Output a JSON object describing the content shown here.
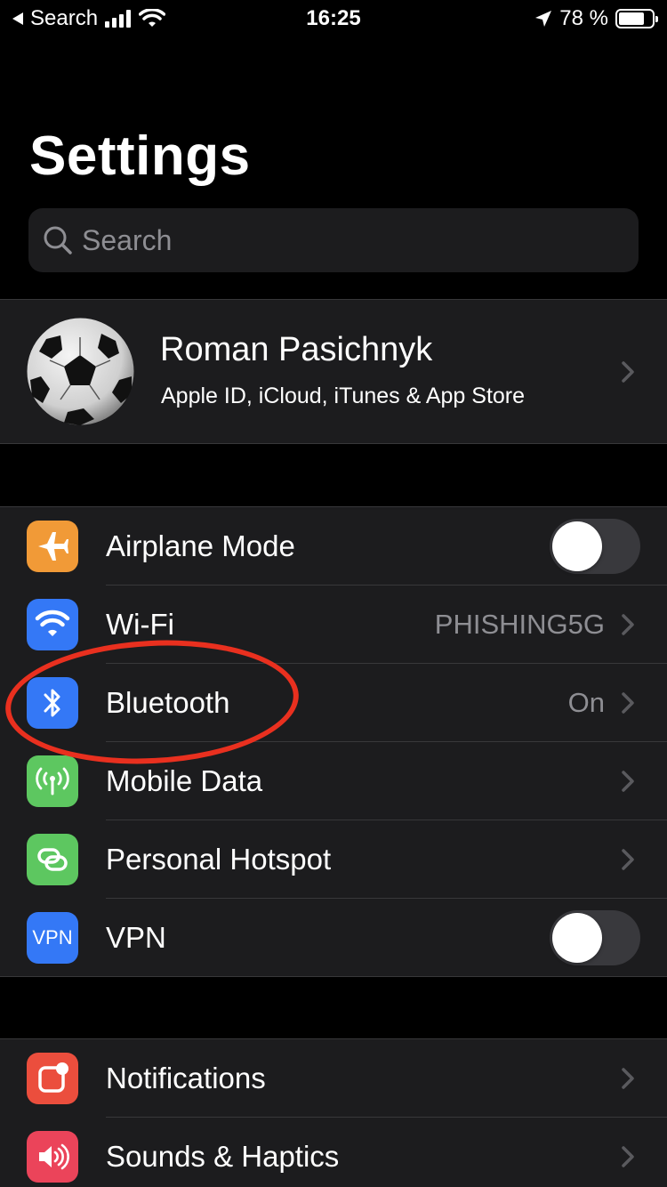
{
  "status_bar": {
    "back_label": "Search",
    "time": "16:25",
    "battery_percent": "78 %",
    "battery_level": 0.78
  },
  "title": "Settings",
  "search": {
    "placeholder": "Search"
  },
  "profile": {
    "name": "Roman Pasichnyk",
    "subtitle": "Apple ID, iCloud, iTunes & App Store"
  },
  "connectivity": [
    {
      "label": "Airplane Mode",
      "icon": "airplane-icon",
      "color": "#f19a37",
      "toggle": false
    },
    {
      "label": "Wi-Fi",
      "icon": "wifi-icon",
      "color": "#3478f6",
      "value": "PHISHING5G"
    },
    {
      "label": "Bluetooth",
      "icon": "bluetooth-icon",
      "color": "#3478f6",
      "value": "On"
    },
    {
      "label": "Mobile Data",
      "icon": "antenna-icon",
      "color": "#5dc760"
    },
    {
      "label": "Personal Hotspot",
      "icon": "hotspot-icon",
      "color": "#5dc760"
    },
    {
      "label": "VPN",
      "icon": "vpn-icon",
      "icon_text": "VPN",
      "color": "#3478f6",
      "toggle": false
    }
  ],
  "general": [
    {
      "label": "Notifications",
      "icon": "notifications-icon",
      "color": "#eb4e3d"
    },
    {
      "label": "Sounds & Haptics",
      "icon": "speaker-icon",
      "color": "#eb445a"
    }
  ],
  "annotation_color": "#e9301f"
}
